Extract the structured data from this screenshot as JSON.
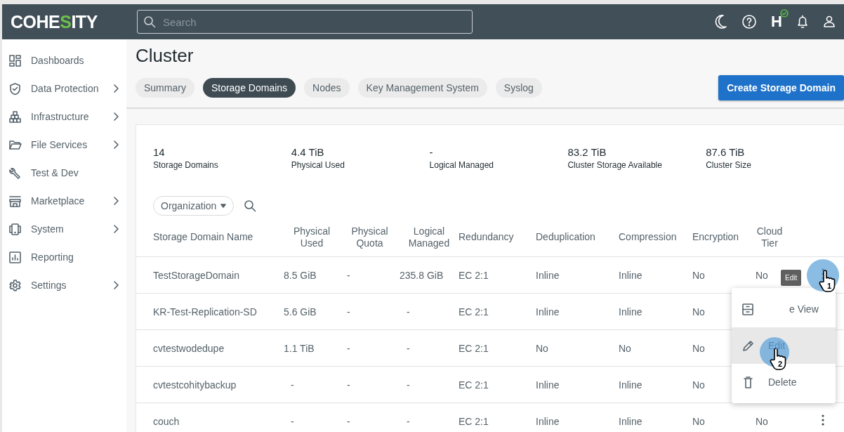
{
  "header": {
    "logo": "COHESITY",
    "search": {
      "placeholder": "Search"
    },
    "status_badge": {
      "text": "H",
      "healthy": true
    }
  },
  "sidebar": {
    "items": [
      {
        "kind": "dashboard",
        "label": "Dashboards",
        "has_submenu": false
      },
      {
        "kind": "shield",
        "label": "Data Protection",
        "has_submenu": true
      },
      {
        "kind": "boxes",
        "label": "Infrastructure",
        "has_submenu": true
      },
      {
        "kind": "folder",
        "label": "File Services",
        "has_submenu": true
      },
      {
        "kind": "wrench",
        "label": "Test & Dev",
        "has_submenu": false
      },
      {
        "kind": "store",
        "label": "Marketplace",
        "has_submenu": true
      },
      {
        "kind": "device",
        "label": "System",
        "has_submenu": true
      },
      {
        "kind": "chart",
        "label": "Reporting",
        "has_submenu": false
      },
      {
        "kind": "gear",
        "label": "Settings",
        "has_submenu": true
      }
    ]
  },
  "page": {
    "title": "Cluster",
    "tabs": [
      {
        "label": "Summary",
        "selected": false
      },
      {
        "label": "Storage Domains",
        "selected": true
      },
      {
        "label": "Nodes",
        "selected": false
      },
      {
        "label": "Key Management System",
        "selected": false
      },
      {
        "label": "Syslog",
        "selected": false
      }
    ],
    "primary_button": "Create Storage Domain"
  },
  "stats": [
    {
      "value": "14",
      "label": "Storage Domains"
    },
    {
      "value": "4.4 TiB",
      "label": "Physical Used"
    },
    {
      "value": "-",
      "label": "Logical Managed"
    },
    {
      "value": "83.2 TiB",
      "label": "Cluster Storage Available"
    },
    {
      "value": "87.6 TiB",
      "label": "Cluster Size"
    }
  ],
  "filter": {
    "label": "Organization"
  },
  "table": {
    "columns": [
      "Storage Domain Name",
      "Physical Used",
      "Physical Quota",
      "Logical Managed",
      "Redundancy",
      "Deduplication",
      "Compression",
      "Encryption",
      "Cloud Tier"
    ],
    "rows": [
      {
        "cells": [
          "TestStorageDomain",
          "8.5 GiB",
          "-",
          "235.8 GiB",
          "EC 2:1",
          "Inline",
          "Inline",
          "No",
          "No"
        ],
        "more_button": true,
        "click_step": "1"
      },
      {
        "cells": [
          "KR-Test-Replication-SD",
          "5.6 GiB",
          "-",
          "-",
          "EC 2:1",
          "Inline",
          "Inline",
          "No"
        ]
      },
      {
        "cells": [
          "cvtestwodedupe",
          "1.1 TiB",
          "-",
          "-",
          "EC 2:1",
          "No",
          "No",
          "No"
        ]
      },
      {
        "cells": [
          "cvtestcohitybackup",
          "-",
          "-",
          "-",
          "EC 2:1",
          "Inline",
          "Inline",
          "No"
        ]
      },
      {
        "cells": [
          "couch",
          "-",
          "-",
          "-",
          "EC 2:1",
          "Inline",
          "Inline",
          "No",
          "No"
        ],
        "more_button": true
      }
    ]
  },
  "menu": {
    "tooltip": "Edit",
    "items": [
      {
        "kind": "cabinet",
        "label": "e View",
        "selected": false
      },
      {
        "kind": "pencil",
        "label": "Edit",
        "selected": true,
        "click_step": "2"
      },
      {
        "kind": "trash",
        "label": "Delete",
        "selected": false
      }
    ]
  }
}
